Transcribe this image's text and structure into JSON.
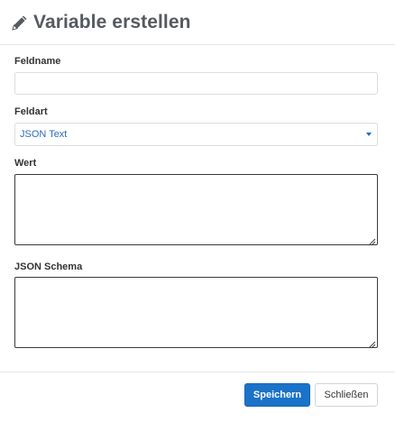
{
  "dialog": {
    "title": "Variable erstellen",
    "title_icon": "pencil-icon"
  },
  "form": {
    "fieldname_label": "Feldname",
    "fieldname_value": "",
    "fieldtype_label": "Feldart",
    "fieldtype_selected": "JSON Text",
    "value_label": "Wert",
    "value_text": "",
    "schema_label": "JSON Schema",
    "schema_text": ""
  },
  "footer": {
    "save_label": "Speichern",
    "close_label": "Schließen"
  },
  "colors": {
    "primary": "#1a73c8",
    "select_text": "#2a6db5",
    "title": "#555a5f"
  }
}
